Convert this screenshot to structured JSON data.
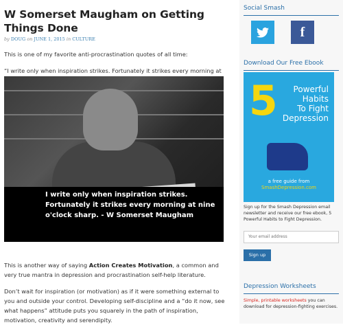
{
  "post": {
    "title": "W Somerset Maugham on Getting Things Done",
    "meta_by": "by",
    "author": "DOUG",
    "meta_on": "on",
    "date": "JUNE 1, 2015",
    "meta_in": "in",
    "category": "CULTURE",
    "p1": "This is one of my favorite anti-procrastination quotes of all time:",
    "p2": "“I write only when inspiration strikes. Fortunately it strikes every morning at nine o’clock sharp.” — W. Somerset Maugham",
    "caption": "I write only when inspiration strikes. Fortunately it strikes every morning at nine o'clock sharp. - W Somerset Maugham",
    "p3_before": "This is another way of saying ",
    "p3_strong": "Action Creates Motivation",
    "p3_after": ", a common and very true mantra in depression and procrastination self-help literature.",
    "p4": "Don’t wait for inspiration (or motivation) as if it were something external to you and outside your control. Developing self-discipline and a “do it now, see what happens” attitude puts you squarely in the path of inspiration, motivation, creativity and serendipity."
  },
  "sidebar": {
    "social_title": "Social Smash",
    "twitter_icon": "twitter-icon",
    "facebook_icon": "facebook-icon",
    "ebook_title": "Download Our Free Ebook",
    "ebook_number": "5",
    "ebook_headline_1": "Powerful",
    "ebook_headline_2": "Habits",
    "ebook_headline_3": "To Fight",
    "ebook_headline_4": "Depression",
    "ebook_free": "a free guide from",
    "ebook_site": "SmashDepression.com",
    "signup_text": "Sign up for the Smash Depression email newsletter and receive our free ebook, 5 Powerful Habits to Fight Depression.",
    "email_placeholder": "Your email address",
    "signup_button": "Sign up",
    "worksheets_title": "Depression Worksheets",
    "worksheets_link": "Simple, printable worksheets",
    "worksheets_rest": " you can download for depression-fighting exercises."
  },
  "colors": {
    "accent": "#2a6fa8",
    "twitter": "#2aa3df",
    "facebook": "#3b5998",
    "ebook_bg": "#29a8df",
    "ebook_yellow": "#f5d60f",
    "link_red": "#d9251d"
  }
}
